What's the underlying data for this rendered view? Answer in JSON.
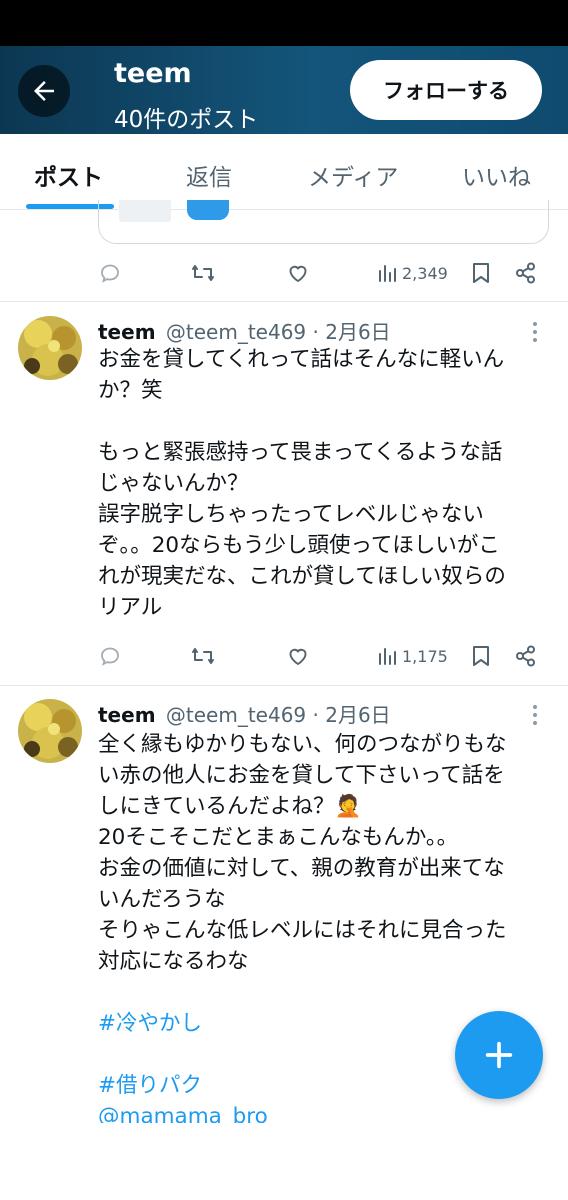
{
  "header": {
    "title": "teem",
    "post_count": "40件のポスト",
    "follow_label": "フォローする"
  },
  "tabs": [
    {
      "label": "ポスト",
      "active": true
    },
    {
      "label": "返信"
    },
    {
      "label": "メディア"
    },
    {
      "label": "いいね"
    }
  ],
  "previous_post": {
    "views": "2,349"
  },
  "posts": [
    {
      "name": "teem",
      "meta": "@teem_te469 · 2月6日",
      "lines": [
        "お金を貸してくれって話はそんなに軽いん",
        "か？笑",
        "",
        "もっと緊張感持って畏まってくるような話",
        "じゃないんか？",
        "誤字脱字しちゃったってレベルじゃない",
        "ぞ。。20ならもう少し頭使ってほしいがこ",
        "れが現実だな、これが貸してほしい奴らの",
        "リアル"
      ],
      "views": "1,175"
    },
    {
      "name": "teem",
      "meta": "@teem_te469 · 2月6日",
      "lines": [
        "全く縁もゆかりもない、何のつながりもな",
        "い赤の他人にお金を貸して下さいって話を",
        "しにきているんだよね？🤦",
        "20そこそこだとまぁこんなもんか。。",
        "お金の価値に対して、親の教育が出来てな",
        "いんだろうな",
        "そりゃこんな低レベルにはそれに見合った",
        "対応になるわな"
      ],
      "hashtags": [
        "#冷やかし",
        "#借りパク"
      ],
      "mention": "@mamama_bro"
    }
  ],
  "icons": {
    "back": "arrow-left-icon",
    "reply": "reply-icon",
    "retweet": "retweet-icon",
    "like": "heart-icon",
    "views": "views-icon",
    "bookmark": "bookmark-icon",
    "share": "share-icon",
    "more": "more-dots-icon",
    "compose": "plus-icon"
  },
  "colors": {
    "accent": "#1d9bf0",
    "header_bg": "#14557b",
    "muted": "#536471"
  }
}
